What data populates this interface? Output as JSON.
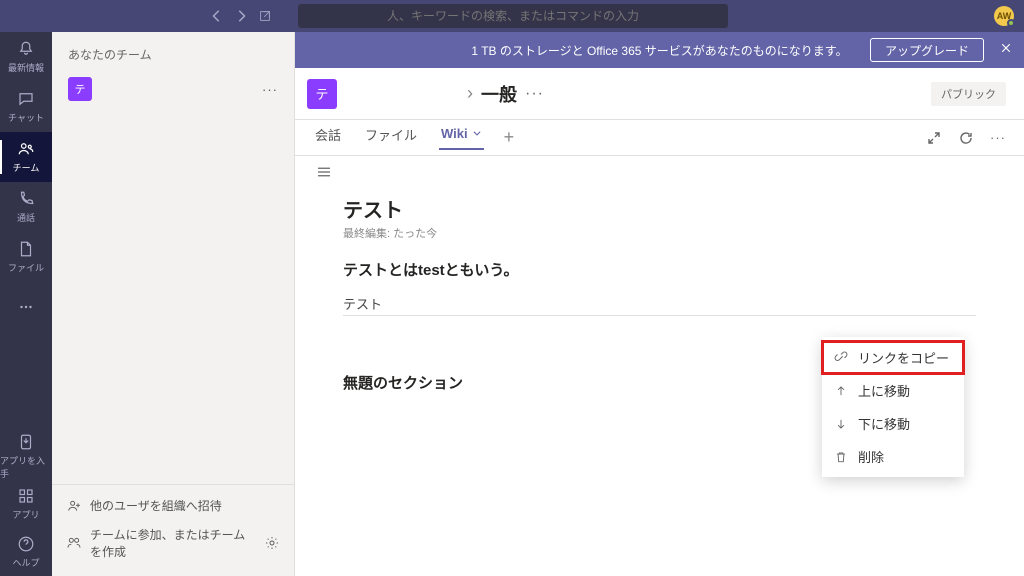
{
  "titlebar": {
    "search_placeholder": "人、キーワードの検索、またはコマンドの入力",
    "avatar_initials": "AW"
  },
  "rail": {
    "items": [
      {
        "label": "最新情報",
        "icon": "bell"
      },
      {
        "label": "チャット",
        "icon": "chat"
      },
      {
        "label": "チーム",
        "icon": "teams"
      },
      {
        "label": "通話",
        "icon": "call"
      },
      {
        "label": "ファイル",
        "icon": "file"
      },
      {
        "label": "",
        "icon": "ellipsis"
      }
    ],
    "bottom": [
      {
        "label": "アプリを入手",
        "icon": "download"
      },
      {
        "label": "アプリ",
        "icon": "apps"
      },
      {
        "label": "ヘルプ",
        "icon": "help"
      }
    ],
    "selected_index": 2
  },
  "teams_pane": {
    "header": "あなたのチーム",
    "team": {
      "initial": "テ"
    },
    "footer": {
      "invite": "他のユーザを組織へ招待",
      "join": "チームに参加、またはチームを作成"
    }
  },
  "banner": {
    "text": "1 TB のストレージと Office 365 サービスがあなたのものになります。",
    "button": "アップグレード"
  },
  "channel_header": {
    "avatar_initial": "テ",
    "title": "一般",
    "badge": "パブリック"
  },
  "tabs": {
    "items": [
      "会話",
      "ファイル",
      "Wiki"
    ],
    "selected_index": 2
  },
  "wiki": {
    "title": "テスト",
    "meta": "最終編集: たった今",
    "line2": "テストとはtestともいう。",
    "line3": "テスト",
    "section": "無題のセクション"
  },
  "context_menu": {
    "items": [
      {
        "label": "リンクをコピー",
        "icon": "link"
      },
      {
        "label": "上に移動",
        "icon": "arrow-up"
      },
      {
        "label": "下に移動",
        "icon": "arrow-down"
      },
      {
        "label": "削除",
        "icon": "trash"
      }
    ],
    "highlight_index": 0
  }
}
